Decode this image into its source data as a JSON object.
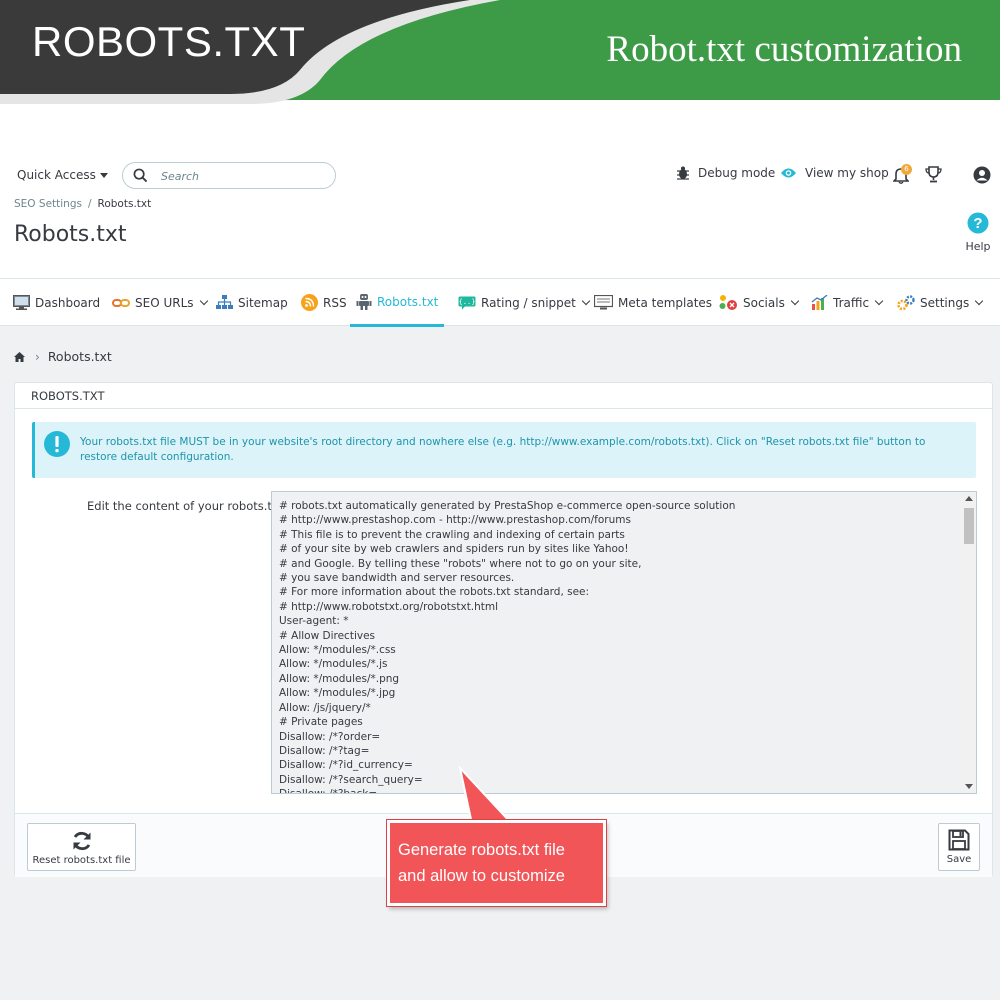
{
  "banner": {
    "title": "ROBOTS.TXT",
    "subtitle": "Robot.txt customization"
  },
  "header": {
    "quick_access": "Quick Access",
    "search_placeholder": "Search",
    "debug_mode": "Debug mode",
    "view_shop": "View my shop",
    "notification_count": "6",
    "breadcrumb": [
      "SEO Settings",
      "Robots.txt"
    ],
    "page_title": "Robots.txt",
    "help_label": "Help"
  },
  "tabs": [
    {
      "label": "Dashboard",
      "icon": "dashboard-icon"
    },
    {
      "label": "SEO URLs",
      "icon": "link-icon",
      "dropdown": true
    },
    {
      "label": "Sitemap",
      "icon": "sitemap-icon"
    },
    {
      "label": "RSS",
      "icon": "rss-icon"
    },
    {
      "label": "Robots.txt",
      "icon": "robot-icon",
      "active": true
    },
    {
      "label": "Rating / snippet",
      "icon": "snippet-icon",
      "dropdown": true
    },
    {
      "label": "Meta templates",
      "icon": "monitor-icon"
    },
    {
      "label": "Socials",
      "icon": "socials-icon",
      "dropdown": true
    },
    {
      "label": "Traffic",
      "icon": "chart-icon",
      "dropdown": true
    },
    {
      "label": "Settings",
      "icon": "gear-icon",
      "dropdown": true
    }
  ],
  "content": {
    "crumb": "Robots.txt",
    "panel_title": "ROBOTS.TXT",
    "alert": "Your robots.txt file MUST be in your website's root directory and nowhere else (e.g. http://www.example.com/robots.txt). Click on \"Reset robots.txt file\" button to restore default configuration.",
    "field_label": "Edit the content of your robots.txt",
    "robots_lines": [
      "# robots.txt automatically generated by PrestaShop e-commerce open-source solution",
      "# http://www.prestashop.com - http://www.prestashop.com/forums",
      "# This file is to prevent the crawling and indexing of certain parts",
      "# of your site by web crawlers and spiders run by sites like Yahoo!",
      "# and Google. By telling these \"robots\" where not to go on your site,",
      "# you save bandwidth and server resources.",
      "# For more information about the robots.txt standard, see:",
      "# http://www.robotstxt.org/robotstxt.html",
      "User-agent: *",
      "# Allow Directives",
      "Allow: */modules/*.css",
      "Allow: */modules/*.js",
      "Allow: */modules/*.png",
      "Allow: */modules/*.jpg",
      "Allow: /js/jquery/*",
      "# Private pages",
      "Disallow: /*?order=",
      "Disallow: /*?tag=",
      "Disallow: /*?id_currency=",
      "Disallow: /*?search_query=",
      "Disallow: /*?back="
    ],
    "reset_label": "Reset robots.txt file",
    "save_label": "Save"
  },
  "callout": {
    "line1": "Generate robots.txt file",
    "line2": "and allow to customize"
  },
  "colors": {
    "accent": "#25b9d7",
    "banner_dark": "#3a3a3a",
    "banner_green": "#3d9a47",
    "callout_red": "#f15558"
  }
}
